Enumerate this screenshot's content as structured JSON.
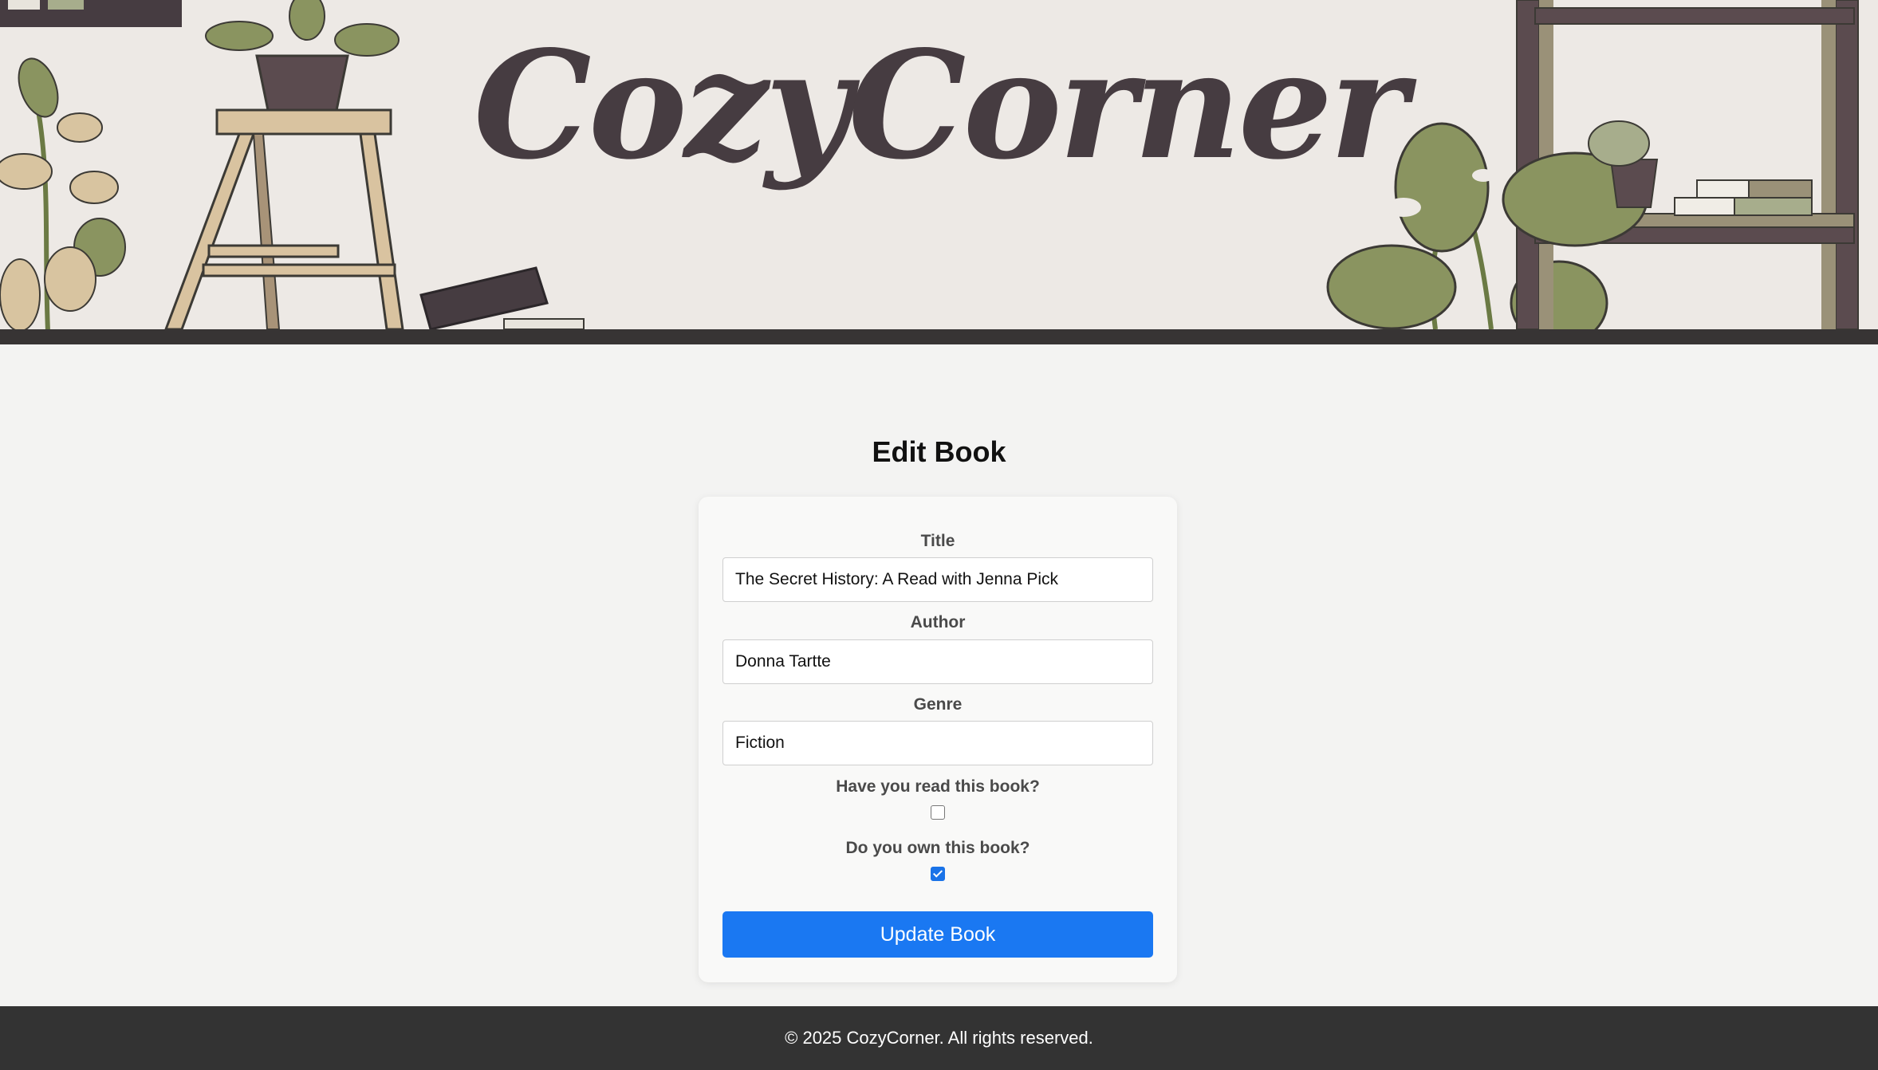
{
  "header": {
    "logo_text": "CozyCorner"
  },
  "page": {
    "title": "Edit Book"
  },
  "form": {
    "title_label": "Title",
    "title_value": "The Secret History: A Read with Jenna Pick",
    "author_label": "Author",
    "author_value": "Donna Tartte",
    "genre_label": "Genre",
    "genre_value": "Fiction",
    "read_label": "Have you read this book?",
    "read_checked": false,
    "own_label": "Do you own this book?",
    "own_checked": true,
    "submit_label": "Update Book"
  },
  "footer": {
    "text": "© 2025 CozyCorner. All rights reserved."
  },
  "colors": {
    "accent": "#1a78f2",
    "logo": "#463c41",
    "banner_bg": "#ede9e5",
    "footer_bg": "#333333"
  }
}
